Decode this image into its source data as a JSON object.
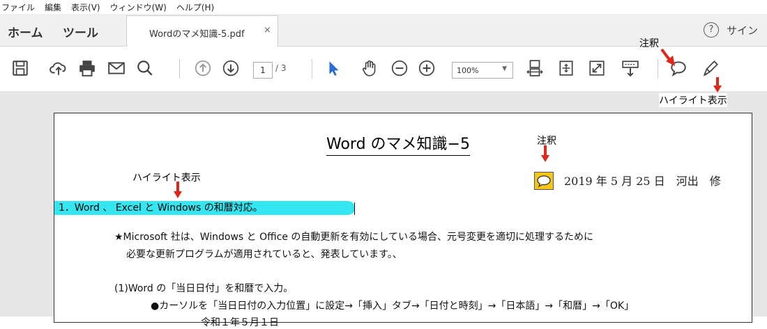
{
  "menu": [
    "ファイル",
    "編集",
    "表示(V)",
    "ウィンドウ(W)",
    "ヘルプ(H)"
  ],
  "tabs": {
    "home": "ホーム",
    "tools": "ツール",
    "document": "Wordのマメ知識-5.pdf",
    "close": "×"
  },
  "header_right": {
    "help": "?",
    "sign": "サイン"
  },
  "toolbar": {
    "icons": [
      "save-icon",
      "upload-icon",
      "print-icon",
      "email-icon",
      "search-icon",
      "page-up-icon",
      "page-down-icon",
      "select-icon",
      "hand-icon",
      "zoom-out-icon",
      "zoom-in-icon",
      "fit-width-icon",
      "fit-page-icon",
      "fullscreen-icon",
      "scroll-icon",
      "comment-icon",
      "highlight-icon"
    ],
    "page_current": "1",
    "page_total": "/ 3",
    "zoom": "100%",
    "zoom_arrow": "▼"
  },
  "annotations": {
    "note_top": "注釈",
    "highlight_top": "ハイライト表示",
    "note_doc": "注釈",
    "highlight_doc": "ハイライト表示"
  },
  "document": {
    "title": "Word のマメ知識−5",
    "date_line": "2019 年 5 月 25 日　河出　修",
    "heading": "1．Word 、 Excel と Windows の和暦対応。",
    "para1": "★Microsoft 社は、Windows と Office の自動更新を有効にしている場合、元号変更を適切に処理するために",
    "para2": "必要な更新プログラムが適用されていると、発表しています。、",
    "para3": "(1)Word の「当日日付」を和暦で入力。",
    "para4": "●カーソルを「当日日付の入力位置」に設定→「挿入」タブ→「日付と時刻」→「日本語」→「和暦」→「OK」",
    "para5": "令和１年５月１日"
  },
  "colors": {
    "highlight": "#33e6f0",
    "note": "#f5c518",
    "arrow": "#e0261b",
    "select_tool": "#2b6cd6"
  }
}
